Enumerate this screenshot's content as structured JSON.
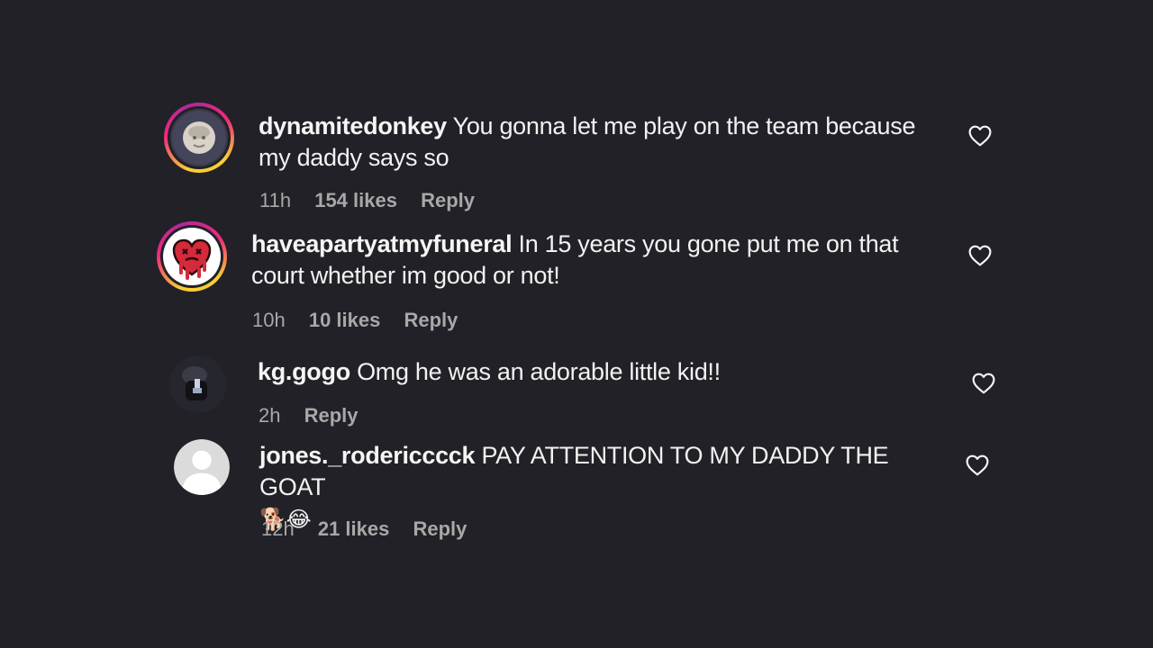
{
  "comments": [
    {
      "username": "dynamitedonkey",
      "text": "You gonna let me play on the team because my daddy says so",
      "time": "11h",
      "likes": "154 likes",
      "reply": "Reply"
    },
    {
      "username": "haveapartyatmyfuneral",
      "text": "In 15 years you gone put me on that court whether im good or not!",
      "time": "10h",
      "likes": "10 likes",
      "reply": "Reply"
    },
    {
      "username": "kg.gogo",
      "text": "Omg he was an adorable little kid!!",
      "time": "2h",
      "reply": "Reply"
    },
    {
      "username": "jones._rodericccck",
      "text": "PAY ATTENTION TO MY DADDY THE GOAT",
      "emoji": "🐕😂",
      "time": "12h",
      "likes": "21 likes",
      "reply": "Reply"
    }
  ],
  "icons": {
    "like": "heart-icon",
    "default_avatar": "default-user-icon",
    "broken_heart_avatar": "melting-heart-icon"
  },
  "colors": {
    "background": "#212127",
    "text": "#f5f5f5",
    "meta": "#a8a8a8",
    "story_ring_start": "#f9ce34",
    "story_ring_end": "#ee2a7b"
  }
}
